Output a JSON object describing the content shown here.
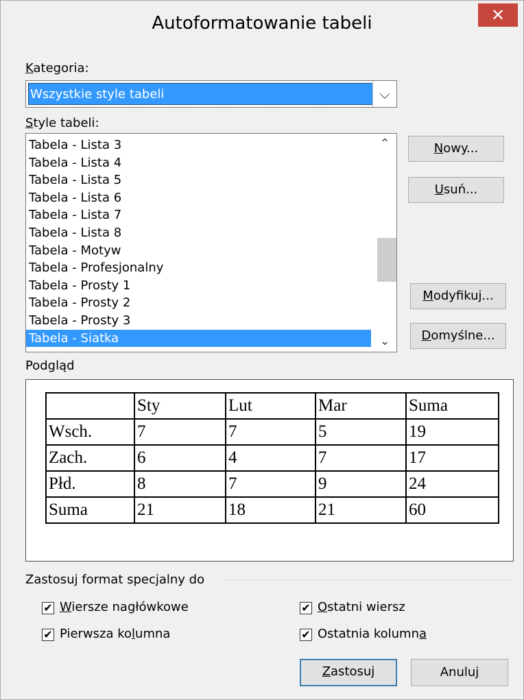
{
  "dialog": {
    "title": "Autoformatowanie tabeli",
    "close_glyph": "✕"
  },
  "category": {
    "label_pre": "",
    "label_key": "K",
    "label_post": "ategoria:",
    "value": "Wszystkie style tabeli"
  },
  "styles": {
    "label_key": "S",
    "label_post": "tyle tabeli:",
    "items": [
      "Tabela - Lista 3",
      "Tabela - Lista 4",
      "Tabela - Lista 5",
      "Tabela - Lista 6",
      "Tabela - Lista 7",
      "Tabela - Lista 8",
      "Tabela - Motyw",
      "Tabela - Profesjonalny",
      "Tabela - Prosty 1",
      "Tabela - Prosty 2",
      "Tabela - Prosty 3",
      "Tabela - Siatka"
    ],
    "selected": "Tabela - Siatka"
  },
  "buttons": {
    "new_key": "N",
    "new_post": "owy...",
    "delete_key": "U",
    "delete_post": "suń...",
    "modify_key": "M",
    "modify_post": "odyfikuj...",
    "default_key": "D",
    "default_post": "omyślne...",
    "apply_key": "Z",
    "apply_post": "astosuj",
    "cancel": "Anuluj"
  },
  "preview": {
    "label": "Podgląd",
    "header": [
      "",
      "Sty",
      "Lut",
      "Mar",
      "Suma"
    ],
    "rows": [
      [
        "Wsch.",
        "7",
        "7",
        "5",
        "19"
      ],
      [
        "Zach.",
        "6",
        "4",
        "7",
        "17"
      ],
      [
        "Płd.",
        "8",
        "7",
        "9",
        "24"
      ],
      [
        "Suma",
        "21",
        "18",
        "21",
        "60"
      ]
    ]
  },
  "special_format": {
    "label": "Zastosuj format specjalny do",
    "header_rows": {
      "pre": "",
      "key": "W",
      "post": "iersze nagłówkowe",
      "checked": true
    },
    "first_column": {
      "pre": "Pierwsza ko",
      "key": "l",
      "post": "umna",
      "checked": true
    },
    "last_row": {
      "pre": "",
      "key": "O",
      "post": "statni wiersz",
      "checked": true
    },
    "last_column": {
      "pre": "Ostatnia kolumn",
      "key": "a",
      "post": "",
      "checked": true
    },
    "check_glyph": "✔"
  }
}
